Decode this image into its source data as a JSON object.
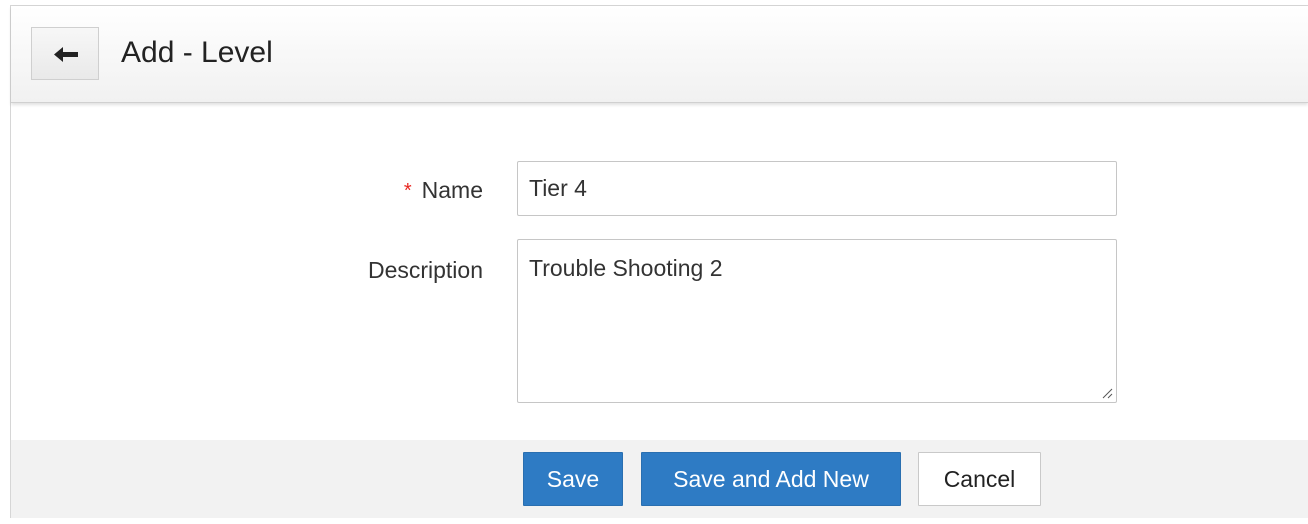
{
  "header": {
    "back_icon": "arrow-left-icon",
    "title": "Add - Level"
  },
  "form": {
    "name": {
      "required_mark": "*",
      "label": "Name",
      "value": "Tier 4"
    },
    "description": {
      "label": "Description",
      "value": "Trouble Shooting 2"
    }
  },
  "actions": {
    "save_label": "Save",
    "save_and_add_new_label": "Save and Add New",
    "cancel_label": "Cancel"
  },
  "colors": {
    "primary": "#2e7bc4",
    "required": "#e8251f",
    "footer_bg": "#f2f2f2"
  }
}
